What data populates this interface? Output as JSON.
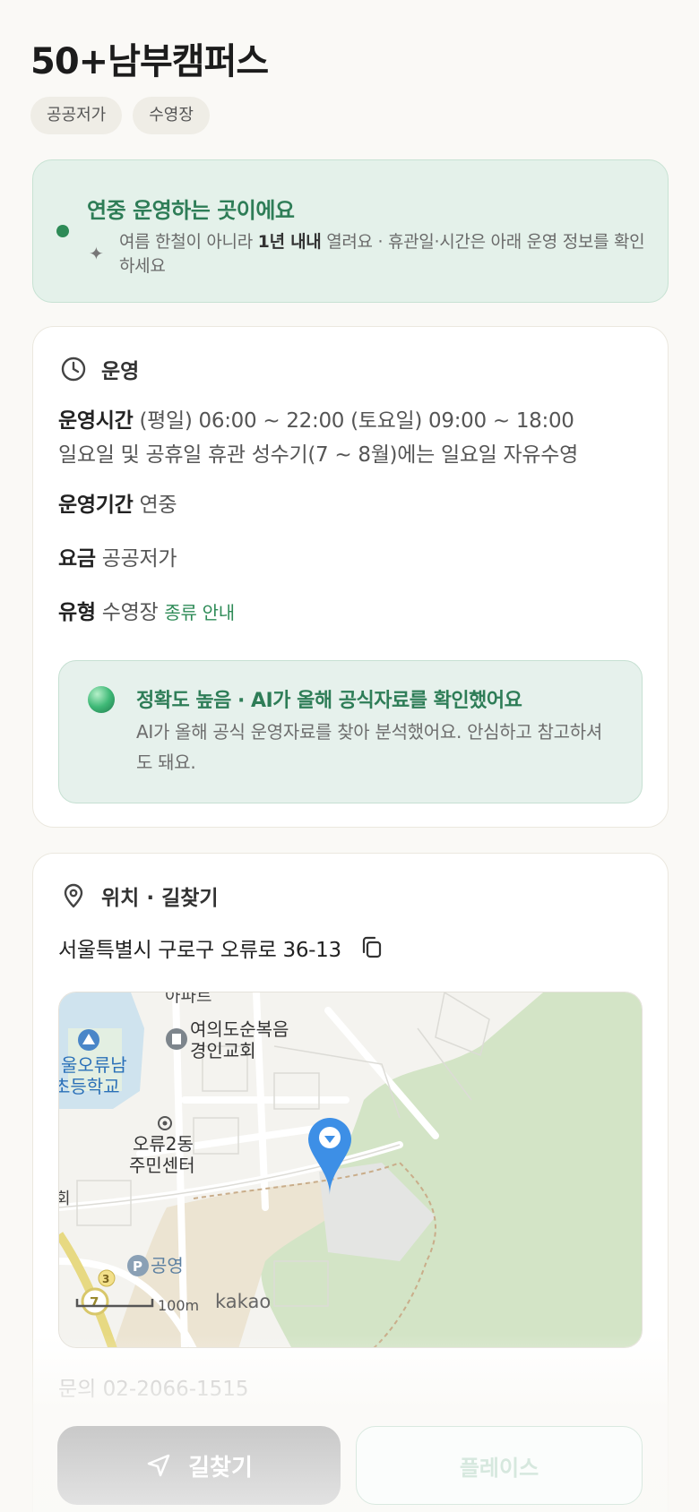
{
  "header": {
    "title": "50+남부캠퍼스",
    "tags": [
      "공공저가",
      "수영장"
    ]
  },
  "notice": {
    "title": "연중 운영하는 곳이에요",
    "text_before": "여름 한철이 아니라 ",
    "text_bold": "1년 내내",
    "text_after": " 열려요 · 휴관일·시간은 아래 운영 정보를 확인하세요"
  },
  "operation": {
    "section_label": "운영",
    "hours_label": "운영시간",
    "hours_value": "(평일) 06:00 ~ 22:00 (토요일) 09:00 ~ 18:00",
    "hours_note": "일요일 및 공휴일 휴관 성수기(7 ~ 8월)에는 일요일 자유수영",
    "period_label": "운영기간",
    "period_value": "연중",
    "fee_label": "요금",
    "fee_value": "공공저가",
    "type_label": "유형",
    "type_value": "수영장",
    "type_link": "종류 안내",
    "ai": {
      "title": "정확도 높음 · AI가 올해 공식자료를 확인했어요",
      "text": "AI가 올해 공식 운영자료를 찾아 분석했어요. 안심하고 참고하셔도 돼요."
    }
  },
  "location": {
    "section_label": "위치 · 길찾기",
    "address": "서울특별시 구로구 오류로 36-13",
    "map": {
      "labels": {
        "apt": "아파트",
        "church": [
          "여의도순복음",
          "경인교회"
        ],
        "school": [
          "울오류남",
          "초등학교"
        ],
        "center": [
          "오류2동",
          "주민센터"
        ],
        "parking": "공영",
        "scale": "100m",
        "brand": "kakao",
        "route3": "3",
        "route7": "7",
        "edge": "회"
      }
    },
    "contact": "문의 02-2066-1515"
  },
  "actions": {
    "directions": "길찾기",
    "place": "플레이스"
  },
  "colors": {
    "accent": "#2e8b57",
    "marker": "#3d8fe6"
  }
}
